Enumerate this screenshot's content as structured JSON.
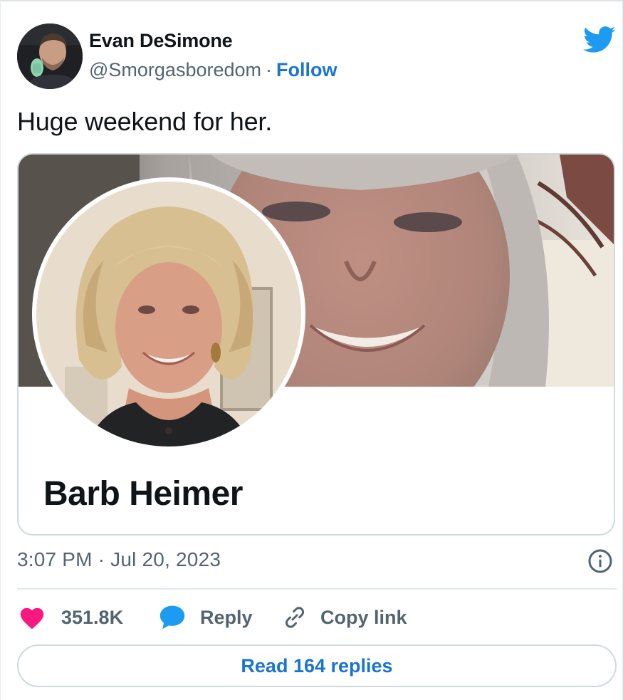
{
  "author": {
    "name": "Evan DeSimone",
    "handle": "@Smorgasboredom",
    "separator": "·",
    "follow_label": "Follow"
  },
  "tweet": {
    "text": "Huge weekend for her.",
    "timestamp": "3:07 PM · Jul 20, 2023"
  },
  "card": {
    "profile_name": "Barb Heimer"
  },
  "actions": {
    "like_count": "351.8K",
    "reply_label": "Reply",
    "copy_link_label": "Copy link",
    "read_replies_label": "Read 164 replies"
  },
  "icons": {
    "twitter": "twitter-bird-icon",
    "info": "info-icon",
    "like": "heart-icon",
    "reply": "speech-bubble-icon",
    "copy": "link-icon"
  },
  "colors": {
    "accent": "#1b74d0",
    "twitter_blue": "#1d9bf0",
    "heart": "#f91880",
    "muted": "#536471",
    "border": "#cfd9de"
  }
}
